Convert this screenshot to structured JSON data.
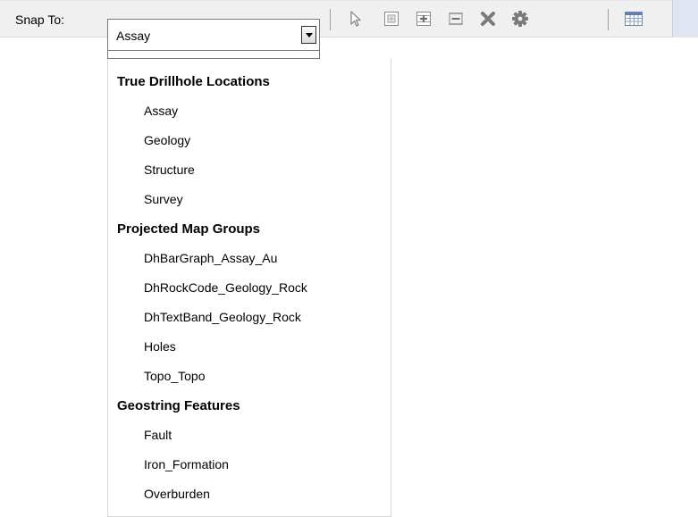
{
  "toolbar": {
    "snap_label": "Snap To:",
    "combo_value": "Assay",
    "icons": [
      "select-arrow-icon",
      "zoom-extent-icon",
      "add-node-icon",
      "remove-node-icon",
      "delete-icon",
      "settings-gear-icon",
      "table-grid-icon"
    ]
  },
  "dropdown": {
    "groups": [
      {
        "header": "True Drillhole Locations",
        "items": [
          "Assay",
          "Geology",
          "Structure",
          "Survey"
        ]
      },
      {
        "header": "Projected Map Groups",
        "items": [
          "DhBarGraph_Assay_Au",
          "DhRockCode_Geology_Rock",
          "DhTextBand_Geology_Rock",
          "Holes",
          "Topo_Topo"
        ]
      },
      {
        "header": "Geostring Features",
        "items": [
          "Fault",
          "Iron_Formation",
          "Overburden"
        ]
      }
    ]
  },
  "colors": {
    "toolbar_bg": "#f0f0f0",
    "icon_gray": "#8a8a8a",
    "accent_blue": "#dfe6f1"
  }
}
